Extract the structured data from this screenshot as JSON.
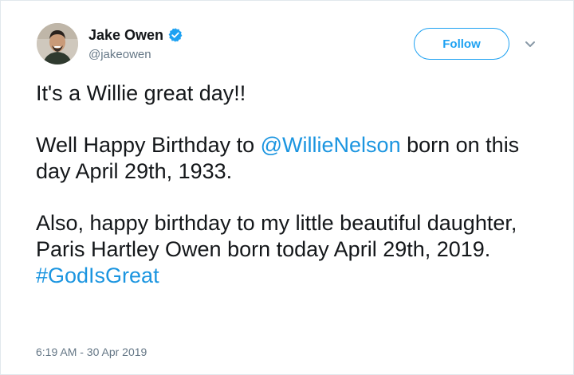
{
  "user": {
    "name": "Jake Owen",
    "handle": "@jakeowen",
    "verified": true
  },
  "actions": {
    "follow_label": "Follow"
  },
  "tweet": {
    "line1": "It's a Willie great day!!",
    "para2_before": "Well Happy Birthday to ",
    "para2_mention": "@WillieNelson",
    "para2_after": " born on this day April 29th, 1933.",
    "para3": "Also, happy birthday to my little beautiful daughter, Paris Hartley Owen born today April 29th, 2019.",
    "hashtag": "#GodIsGreat"
  },
  "meta": {
    "timestamp": "6:19 AM - 30 Apr 2019"
  },
  "colors": {
    "accent": "#1da1f2",
    "link": "#1b95e0",
    "text": "#14171a",
    "secondary": "#657786"
  },
  "icons": {
    "verified": "verified-badge-icon",
    "menu": "chevron-down-icon"
  }
}
